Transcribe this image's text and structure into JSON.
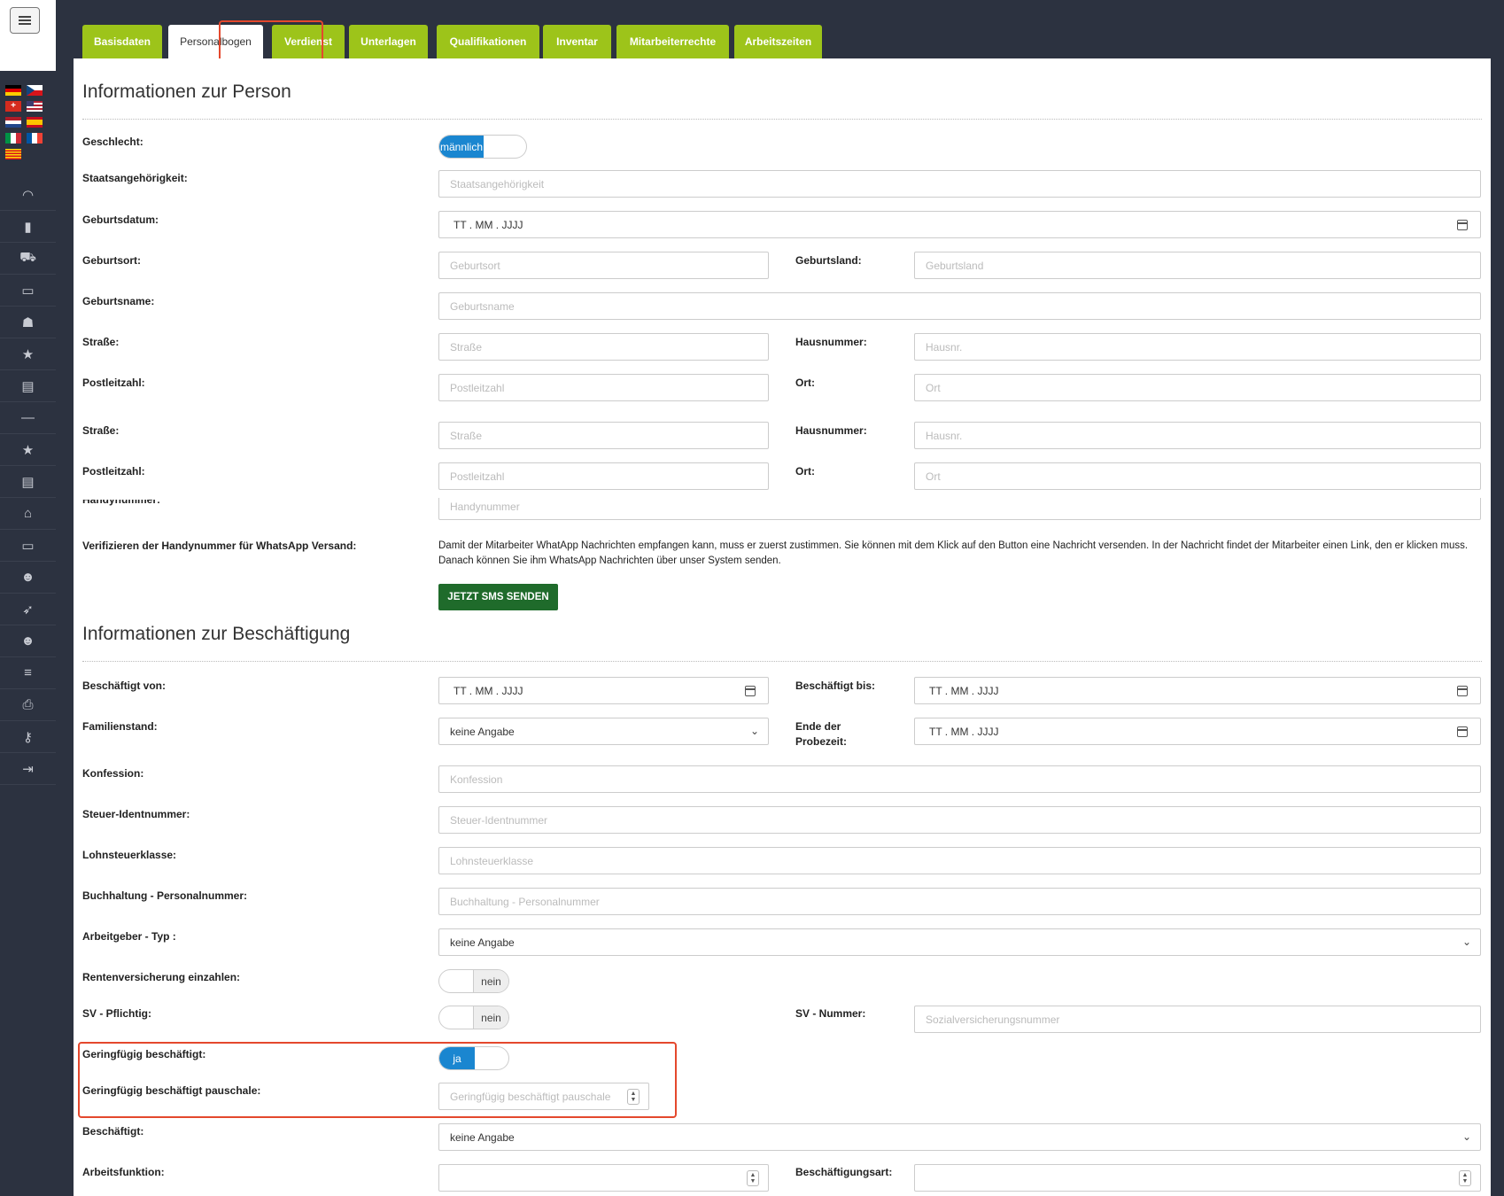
{
  "tabs": [
    {
      "label": "Basisdaten"
    },
    {
      "label": "Personalbogen"
    },
    {
      "label": "Verdienst"
    },
    {
      "label": "Unterlagen"
    },
    {
      "label": "Qualifikationen"
    },
    {
      "label": "Inventar"
    },
    {
      "label": "Mitarbeiterrechte"
    },
    {
      "label": "Arbeitszeiten"
    }
  ],
  "person": {
    "title": "Informationen zur Person",
    "geschlecht_label": "Geschlecht:",
    "geschlecht_value": "männlich",
    "staatsangehoerigkeit_label": "Staatsangehörigkeit:",
    "staatsangehoerigkeit_placeholder": "Staatsangehörigkeit",
    "geburtsdatum_label": "Geburtsdatum:",
    "geburtsdatum_value": "TT . MM . JJJJ",
    "geburtsort_label": "Geburtsort:",
    "geburtsort_placeholder": "Geburtsort",
    "geburtsland_label": "Geburtsland:",
    "geburtsland_placeholder": "Geburtsland",
    "geburtsname_label": "Geburtsname:",
    "geburtsname_placeholder": "Geburtsname",
    "strasse_label": "Straße:",
    "strasse_placeholder": "Straße",
    "hausnummer_label": "Hausnummer:",
    "hausnummer_placeholder": "Hausnr.",
    "plz_label": "Postleitzahl:",
    "plz_placeholder": "Postleitzahl",
    "ort_label": "Ort:",
    "ort_placeholder": "Ort",
    "handynummer_label": "Handynummer:",
    "handynummer_placeholder": "Handynummer",
    "whatsapp_label": "Verifizieren der Handynummer für WhatsApp Versand:",
    "whatsapp_text": "Damit der Mitarbeiter WhatApp Nachrichten empfangen kann, muss er zuerst zustimmen. Sie können mit dem Klick auf den Button eine Nachricht versenden. In der Nachricht findet der Mitarbeiter einen Link, den er klicken muss. Danach können Sie ihm WhatsApp Nachrichten über unser System senden.",
    "sms_button": "JETZT SMS SENDEN"
  },
  "employment": {
    "title": "Informationen zur Beschäftigung",
    "von_label": "Beschäftigt von:",
    "von_value": "TT . MM . JJJJ",
    "bis_label": "Beschäftigt bis:",
    "bis_value": "TT . MM . JJJJ",
    "familienstand_label": "Familienstand:",
    "familienstand_value": "keine Angabe",
    "probezeit_label": "Ende der Probezeit:",
    "probezeit_value": "TT . MM . JJJJ",
    "konfession_label": "Konfession:",
    "konfession_placeholder": "Konfession",
    "steuer_label": "Steuer-Identnummer:",
    "steuer_placeholder": "Steuer-Identnummer",
    "lohnsteuer_label": "Lohnsteuerklasse:",
    "lohnsteuer_placeholder": "Lohnsteuerklasse",
    "buchhaltung_label": "Buchhaltung - Personalnummer:",
    "buchhaltung_placeholder": "Buchhaltung - Personalnummer",
    "arbeitgeber_label": "Arbeitgeber - Typ :",
    "arbeitgeber_value": "keine Angabe",
    "rente_label": "Rentenversicherung einzahlen:",
    "rente_value": "nein",
    "sv_label": "SV - Pflichtig:",
    "sv_value": "nein",
    "svnr_label": "SV - Nummer:",
    "svnr_placeholder": "Sozialversicherungsnummer",
    "gering_label": "Geringfügig beschäftigt:",
    "gering_value": "ja",
    "pauschale_label": "Geringfügig beschäftigt pauschale:",
    "pauschale_placeholder": "Geringfügig beschäftigt pauschale",
    "beschaeftigt_label": "Beschäftigt:",
    "beschaeftigt_value": "keine Angabe",
    "funktion_label": "Arbeitsfunktion:",
    "art_label": "Beschäftigungsart:"
  },
  "sidebar_icons": [
    "speedometer-icon",
    "bar-chart-icon",
    "cart-icon",
    "monitor-icon",
    "user-add-icon",
    "star-icon",
    "archive-icon",
    "minus-icon",
    "star-icon",
    "archive-icon",
    "home-icon",
    "monitor-icon",
    "user-icon",
    "rocket-icon",
    "users-icon",
    "database-icon",
    "printer-icon",
    "key-icon",
    "logout-icon"
  ],
  "colors": {
    "tab_green": "#9dc41a",
    "toggle_blue": "#1a86d0",
    "sms_green": "#1f6b2b",
    "highlight_red": "#e4482d"
  }
}
